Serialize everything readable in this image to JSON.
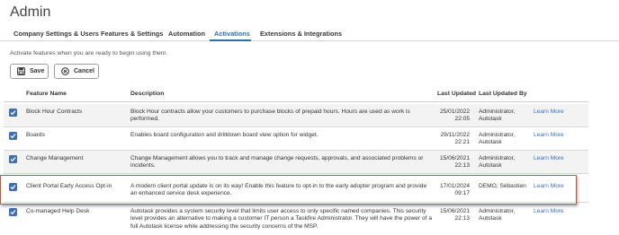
{
  "page": {
    "title": "Admin"
  },
  "tabs": [
    {
      "label": "Company Settings & Users"
    },
    {
      "label": "Features & Settings"
    },
    {
      "label": "Automation"
    },
    {
      "label": "Activations",
      "active": true
    },
    {
      "label": "Extensions & Integrations"
    }
  ],
  "instructions": "Activate features when you are ready to begin using them.",
  "toolbar": {
    "save_label": "Save",
    "cancel_label": "Cancel"
  },
  "table": {
    "headers": {
      "name": "Feature Name",
      "description": "Description",
      "last_updated": "Last Updated",
      "last_updated_by": "Last Updated By"
    },
    "rows": [
      {
        "checked": true,
        "name": "Block Hour Contracts",
        "description": "Block Hour contracts allow your customers to purchase blocks of prepaid hours. Hours are used as work is performed.",
        "date": "25/01/2022",
        "time": "22:05",
        "by_line1": "Administrator,",
        "by_line2": "Autotask",
        "link": "Learn More"
      },
      {
        "checked": true,
        "name": "Boards",
        "description": "Enables board configuration and drilldown board view option for widget.",
        "date": "29/11/2022",
        "time": "22:21",
        "by_line1": "Administrator,",
        "by_line2": "Autotask",
        "link": "Learn More"
      },
      {
        "checked": true,
        "name": "Change Management",
        "description": "Change Management allows you to track and manage change requests, approvals, and associated problems or incidents.",
        "date": "15/06/2021",
        "time": "22:13",
        "by_line1": "Administrator,",
        "by_line2": "Autotask",
        "link": "Learn More"
      },
      {
        "checked": true,
        "name": "Client Portal Early Access Opt-in",
        "description": "A modern client portal update is on its way! Enable this feature to opt-in to the early adopter program and provide an enhanced service desk experience.",
        "date": "17/01/2024",
        "time": "09:17",
        "by_line1": "DEMO, Sébastien",
        "by_line2": "",
        "link": "Learn More"
      },
      {
        "checked": true,
        "name": "Co-managed Help Desk",
        "description": "Autotask provides a system security level that limits user access to only specific named companies. This security level provides an alternative to making a customer IT person a Taskfire Administrator. They will have the power of a full Autotask license while addressing the security concerns of the MSP.",
        "date": "15/06/2021",
        "time": "22:13",
        "by_line1": "Administrator,",
        "by_line2": "Autotask",
        "link": "Learn More"
      }
    ]
  },
  "colors": {
    "accent": "#2a6fb0",
    "checkbox": "#3f6fb3",
    "highlight_border": "#c9533a",
    "link": "#3a6fc0"
  },
  "icons": {
    "save": "floppy-disk-icon",
    "cancel": "cancel-circle-icon",
    "checkbox": "checkmark-icon"
  }
}
